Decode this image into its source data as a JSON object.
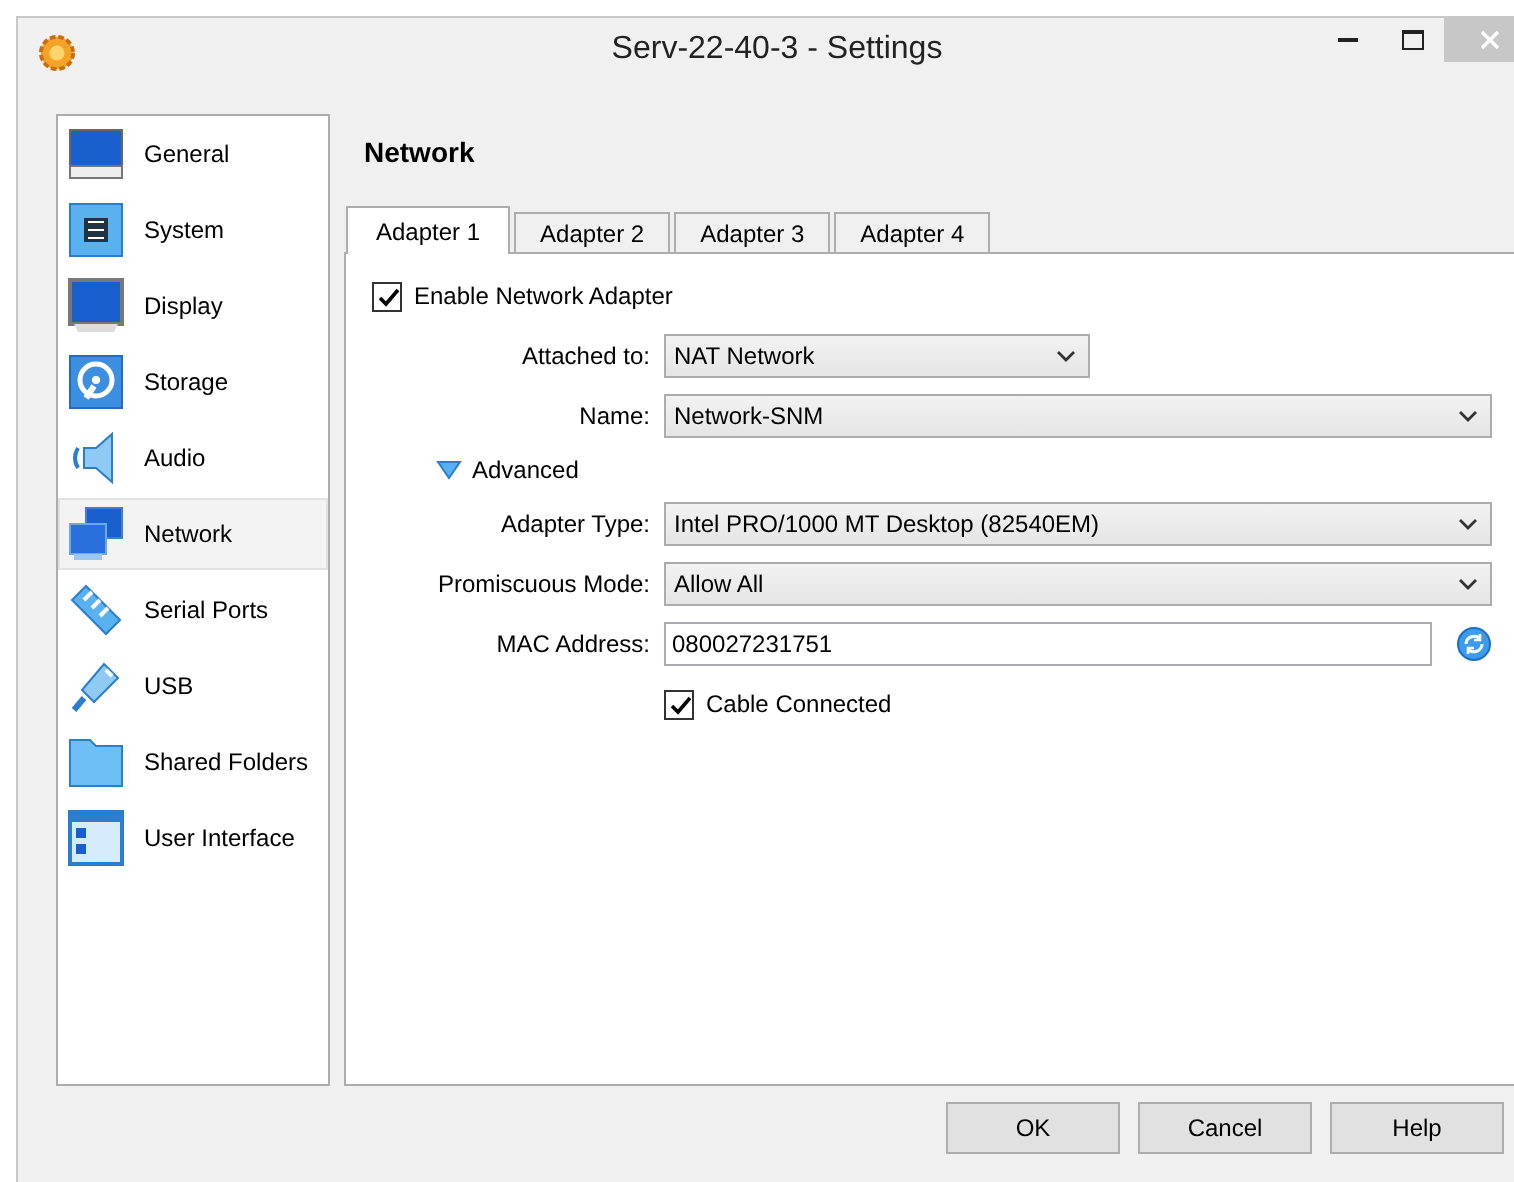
{
  "window": {
    "title": "Serv-22-40-3 - Settings"
  },
  "sidebar": {
    "items": [
      {
        "label": "General",
        "selected": false
      },
      {
        "label": "System",
        "selected": false
      },
      {
        "label": "Display",
        "selected": false
      },
      {
        "label": "Storage",
        "selected": false
      },
      {
        "label": "Audio",
        "selected": false
      },
      {
        "label": "Network",
        "selected": true
      },
      {
        "label": "Serial Ports",
        "selected": false
      },
      {
        "label": "USB",
        "selected": false
      },
      {
        "label": "Shared Folders",
        "selected": false
      },
      {
        "label": "User Interface",
        "selected": false
      }
    ]
  },
  "page": {
    "heading": "Network",
    "tabs": [
      {
        "label": "Adapter 1",
        "selected": true
      },
      {
        "label": "Adapter 2",
        "selected": false
      },
      {
        "label": "Adapter 3",
        "selected": false
      },
      {
        "label": "Adapter 4",
        "selected": false
      }
    ],
    "rows": [
      {
        "kind": "checkbox",
        "label": "Enable Network Adapter",
        "checked": true
      },
      {
        "kind": "narrow_combo",
        "label": "Attached to:",
        "value": "NAT Network"
      },
      {
        "kind": "combo",
        "label": "Name:",
        "value": "Network-SNM"
      },
      {
        "kind": "expander",
        "label": "Advanced",
        "expanded": true
      },
      {
        "kind": "combo",
        "label": "Adapter Type:",
        "value": "Intel PRO/1000 MT Desktop (82540EM)"
      },
      {
        "kind": "combo",
        "label": "Promiscuous Mode:",
        "value": "Allow All"
      },
      {
        "kind": "text",
        "label": "MAC Address:",
        "value": "080027231751"
      },
      {
        "kind": "subcheckbox",
        "label": "Cable Connected",
        "checked": true
      }
    ]
  },
  "buttons": [
    "OK",
    "Cancel",
    "Help"
  ]
}
